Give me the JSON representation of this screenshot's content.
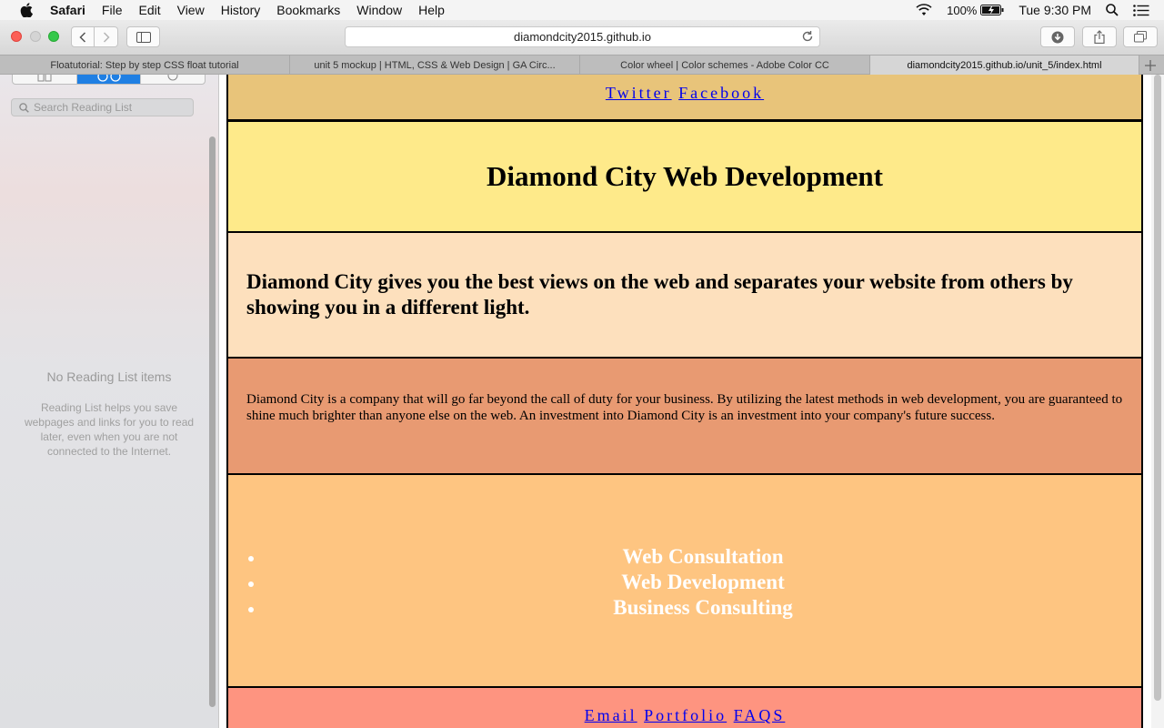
{
  "menubar": {
    "app": "Safari",
    "items": [
      "File",
      "Edit",
      "View",
      "History",
      "Bookmarks",
      "Window",
      "Help"
    ],
    "battery": "100%",
    "clock": "Tue 9:30 PM"
  },
  "toolbar": {
    "address": "diamondcity2015.github.io"
  },
  "tabs": [
    {
      "label": "Floatutorial: Step by step CSS float tutorial"
    },
    {
      "label": "unit 5 mockup | HTML, CSS & Web Design | GA Circ..."
    },
    {
      "label": "Color wheel | Color schemes - Adobe Color CC"
    },
    {
      "label": "diamondcity2015.github.io/unit_5/index.html"
    }
  ],
  "sidebar": {
    "search_placeholder": "Search Reading List",
    "empty_title": "No Reading List items",
    "empty_description": "Reading List helps you save webpages and links for you to read later, even when you are not connected to the Internet."
  },
  "page": {
    "social_links": [
      "Twitter",
      "Facebook"
    ],
    "heading": "Diamond City Web Development",
    "tagline": "Diamond City gives you the best views on the web and separates your website from others by showing you in a different light.",
    "about": "Diamond City is a company that will go far beyond the call of duty for your business. By utilizing the latest methods in web development, you are guaranteed to shine much brighter than anyone else on the web. An investment into Diamond City is an investment into your company's future success.",
    "services": [
      "Web Consultation",
      "Web Development",
      "Business Consulting"
    ],
    "contact_links": [
      "Email",
      "Portfolio",
      "FAQS"
    ]
  },
  "colors": {
    "social_bg": "#e8c47a",
    "header_bg": "#feea8a",
    "tagline_bg": "#fde0bd",
    "about_bg": "#e89a72",
    "services_bg": "#fec581",
    "contact_bg": "#fe9480",
    "link": "#0000ee"
  }
}
